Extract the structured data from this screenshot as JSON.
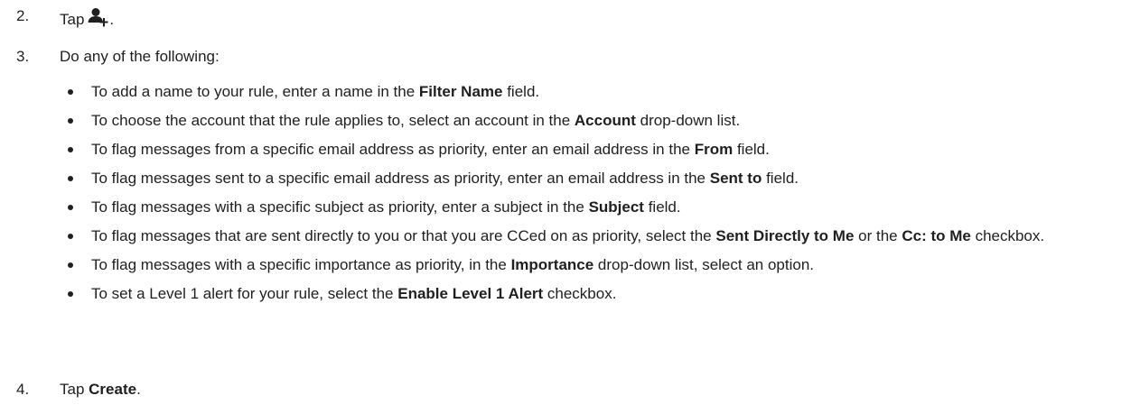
{
  "steps": [
    {
      "num": "2.",
      "pre": "Tap",
      "icon": "add-contact-icon",
      "post": "."
    },
    {
      "num": "3.",
      "text": "Do any of the following:"
    },
    {
      "num": "4.",
      "pre": "Tap ",
      "bold": "Create",
      "post": "."
    }
  ],
  "bullets": [
    {
      "pre": "To add a name to your rule, enter a name in the ",
      "bold": "Filter Name",
      "post": " field."
    },
    {
      "pre": "To choose the account that the rule applies to, select an account in the ",
      "bold": "Account",
      "post": " drop-down list."
    },
    {
      "pre": "To flag messages from a specific email address as priority, enter an email address in the ",
      "bold": "From",
      "post": " field."
    },
    {
      "pre": "To flag messages sent to a specific email address as priority, enter an email address in the ",
      "bold": "Sent to",
      "post": " field."
    },
    {
      "pre": "To flag messages with a specific subject as priority, enter a subject in the ",
      "bold": "Subject",
      "post": " field."
    },
    {
      "pre": "To flag messages that are sent directly to you or that you are CCed on as priority, select the ",
      "bold": "Sent Directly to Me",
      "mid": " or the ",
      "bold2": "Cc: to Me",
      "post": " checkbox."
    },
    {
      "pre": "To flag messages with a specific importance as priority, in the ",
      "bold": "Importance",
      "post": " drop-down list, select an option."
    },
    {
      "pre": "To set a Level 1 alert for your rule, select the ",
      "bold": "Enable Level 1 Alert",
      "post": " checkbox."
    }
  ]
}
